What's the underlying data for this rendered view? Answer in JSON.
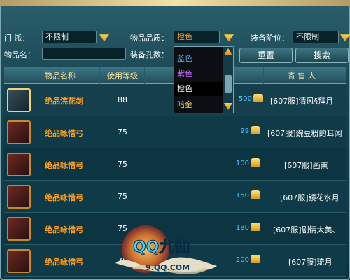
{
  "filters": {
    "sect_label": "门  派：",
    "sect_value": "不限制",
    "quality_label": "物品品质：",
    "quality_value": "橙色",
    "equip_level_label": "装备阶位：",
    "equip_level_value": "不限制",
    "item_name_label": "物品名：",
    "item_name_value": "",
    "socket_label": "装备孔数：",
    "reset_label": "重置",
    "search_label": "搜索"
  },
  "quality_dropdown": {
    "options": [
      {
        "label": "蓝色",
        "color": "#4fb4ff"
      },
      {
        "label": "紫色",
        "color": "#c466ff"
      },
      {
        "label": "橙色",
        "color": "#ffffff"
      },
      {
        "label": "暗金",
        "color": "#d8cb4a"
      }
    ],
    "selected_index": 2
  },
  "table": {
    "headers": [
      "物品名称",
      "使用等级",
      "寄 售 人"
    ],
    "rows": [
      {
        "name": "绝品浣花剑",
        "level": "88",
        "price": "500",
        "seller": "[607服]清风§拜月"
      },
      {
        "name": "绝品咏惜弓",
        "level": "75",
        "price": "99",
        "seller": "[607服]豌豆粉的耳闻"
      },
      {
        "name": "绝品咏惜弓",
        "level": "75",
        "price": "100",
        "seller": "[607服]画熏"
      },
      {
        "name": "绝品咏惜弓",
        "level": "75",
        "price": "150",
        "seller": "[607服]镜花水月"
      },
      {
        "name": "绝品咏惜弓",
        "level": "75",
        "price": "180",
        "seller": "[607服]剧情太美、"
      },
      {
        "name": "绝品咏惜弓",
        "level": "75",
        "price": "200",
        "seller": "[607服]琉月"
      }
    ]
  },
  "logo": {
    "main": "QQ九仙",
    "sub": "9.QQ.COM"
  },
  "colors": {
    "orange_text": "#ff9f1a",
    "price_blue": "#52c8ff",
    "header_gold": "#ffe69a"
  }
}
